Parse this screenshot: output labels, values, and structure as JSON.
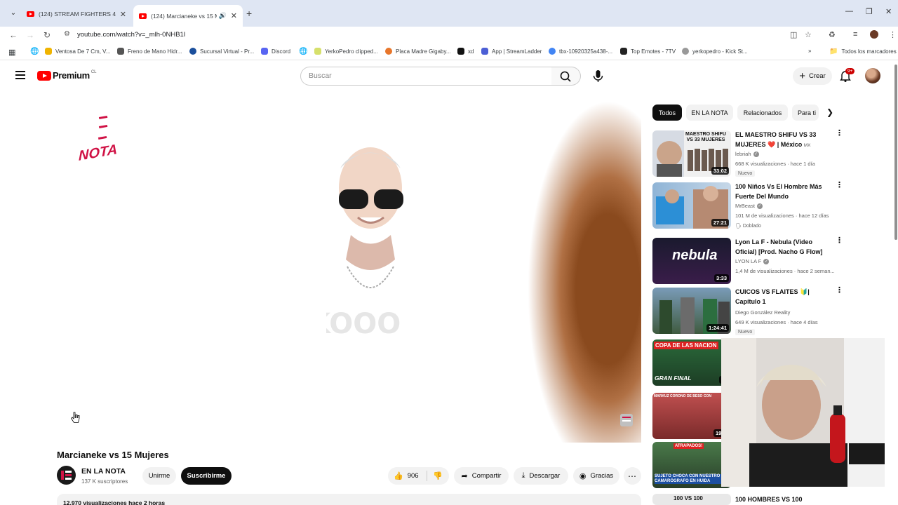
{
  "browser": {
    "tabs": [
      {
        "title": "(124) STREAM FIGHTERS 4 \"DIFI"
      },
      {
        "title": "(124) Marcianeke vs 15 Mu"
      }
    ],
    "url": "youtube.com/watch?v=_mlh-0NHB1I",
    "bookmarks": [
      "Ventosa De 7 Cm, V...",
      "Freno de Mano Hidr...",
      "Sucursal Virtual - Pr...",
      "Discord",
      "YerkoPedro clipped...",
      "Placa Madre Gigaby...",
      "xd",
      "App | StreamLadder",
      "tbx-10920325a438-...",
      "Top Emotes - 7TV",
      "yerkopedro - Kick St..."
    ],
    "all_bookmarks": "Todos los marcadores"
  },
  "header": {
    "logo": "Premium",
    "country": "CL",
    "search_placeholder": "Buscar",
    "create": "Crear",
    "notifications": "9+"
  },
  "player": {
    "overlay_logo": "NOTA"
  },
  "video": {
    "title": "Marcianeke vs 15 Mujeres",
    "channel": "EN LA NOTA",
    "subscribers": "137 K suscriptores",
    "join": "Unirme",
    "subscribe": "Suscribirme",
    "likes": "906",
    "share": "Compartir",
    "download": "Descargar",
    "thanks": "Gracias",
    "views_line": "12.970 visualizaciones  hace 2 horas"
  },
  "sidebar": {
    "chips": [
      "Todos",
      "EN LA NOTA",
      "Relacionados",
      "Para ti"
    ],
    "videos": [
      {
        "title": "EL MAESTRO SHIFU VS 33 MUJERES ❤️ | México",
        "suffix": "MX",
        "channel": "lebriah",
        "stats": "668 K visualizaciones · hace 1 día",
        "tag": "Nuevo",
        "duration": "33:02",
        "thumb_text": "MAESTRO SHIFU VS 33 MUJERES"
      },
      {
        "title": "100 Niños Vs El Hombre Más Fuerte Del Mundo",
        "channel": "MrBeast",
        "stats": "101 M de visualizaciones · hace 12 días",
        "tag": "Doblado",
        "duration": "27:21"
      },
      {
        "title": "Lyon La F - Nebula (Video Oficial) [Prod. Nacho G Flow]",
        "channel": "LYON LA F",
        "stats": "1,4 M de visualizaciones · hace 2 seman...",
        "duration": "3:33",
        "thumb_text": "nebula"
      },
      {
        "title": "CUICOS VS FLAITES 🔰| Capítulo 1",
        "channel": "Diego González Reality",
        "stats": "649 K visualizaciones · hace 4 días",
        "tag": "Nuevo",
        "duration": "1:24:41"
      },
      {
        "duration": "41",
        "thumb_text": "COPA DE LAS NACION",
        "thumb_text2": "GRAN FINAL"
      },
      {
        "duration": "19",
        "thumb_text": "MARKUZ CORONO DE BESO CON"
      },
      {
        "duration": "",
        "thumb_text": "ATRAPADOS!",
        "thumb_text2": "SUJETO CHOCA CON NUESTRO CAMARÓGRAFO EN HUIDA"
      },
      {
        "title": "100 HOMBRES VS 100",
        "thumb_text": "100 VS 100"
      }
    ]
  }
}
